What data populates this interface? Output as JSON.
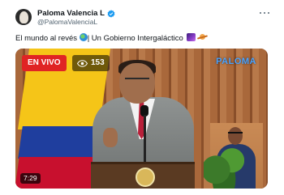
{
  "author": {
    "display_name": "Paloma Valencia L",
    "handle": "@PalomaValenciaL"
  },
  "tweet": {
    "text_part1": "El mundo al revés ",
    "text_part2": "| Un Gobierno Intergaláctico "
  },
  "video": {
    "live_label": "EN VIVO",
    "viewer_count": "153",
    "watermark": "PALOMA",
    "duration": "7:29"
  },
  "icons": [
    "verified-badge",
    "more-options",
    "globe-emoji",
    "galaxy-emoji",
    "saturn-emoji",
    "eye"
  ],
  "colors": {
    "verified": "#1d9bf0",
    "live": "#e02424",
    "watermark": "#4aa3ff"
  }
}
